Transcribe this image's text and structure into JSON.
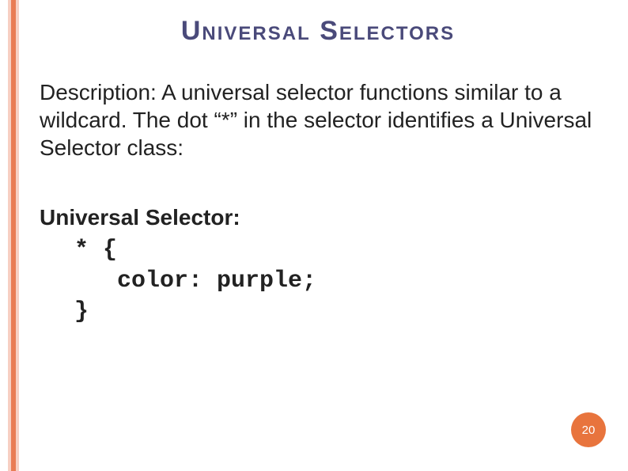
{
  "slide": {
    "title": "Universal Selectors",
    "description": "Description: A universal selector functions similar to a wildcard. The dot “*” in the selector identifies a Universal Selector class:",
    "label": "Universal Selector:",
    "code": "* {\n   color: purple;\n}",
    "page_number": "20"
  }
}
